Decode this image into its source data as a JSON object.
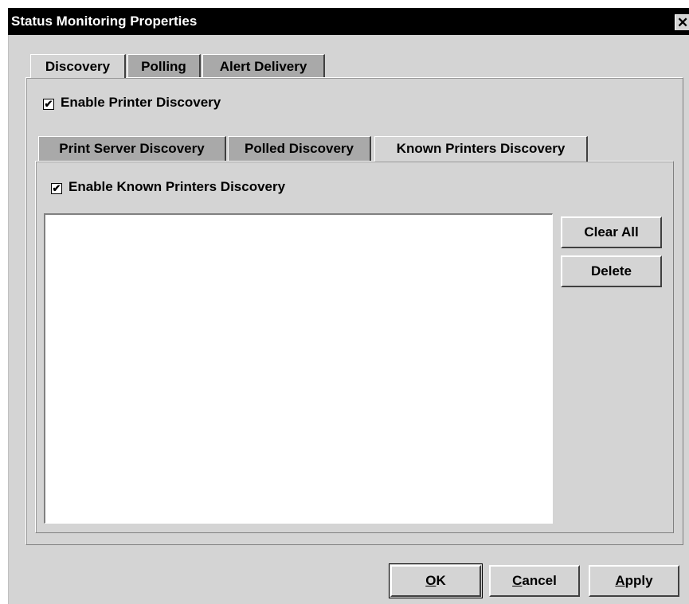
{
  "window": {
    "title": "Status Monitoring Properties",
    "close_glyph": "✕"
  },
  "outer_tabs": [
    {
      "label": "Discovery",
      "selected": true
    },
    {
      "label": "Polling",
      "selected": false
    },
    {
      "label": "Alert Delivery",
      "selected": false
    }
  ],
  "discovery": {
    "enable_printer_discovery": {
      "label": "Enable Printer Discovery",
      "checked": true,
      "mark": "✔"
    },
    "inner_tabs": [
      {
        "label": "Print Server Discovery",
        "selected": false
      },
      {
        "label": "Polled Discovery",
        "selected": false
      },
      {
        "label": "Known Printers Discovery",
        "selected": true
      }
    ],
    "known_printers": {
      "enable_label": "Enable Known Printers Discovery",
      "checked": true,
      "mark": "✔",
      "items": [],
      "clear_all_label": "Clear All",
      "delete_label": "Delete"
    }
  },
  "footer": {
    "ok": {
      "mnemonic": "O",
      "rest": "K"
    },
    "cancel": {
      "mnemonic": "C",
      "rest": "ancel"
    },
    "apply": {
      "mnemonic": "A",
      "rest": "pply"
    }
  }
}
